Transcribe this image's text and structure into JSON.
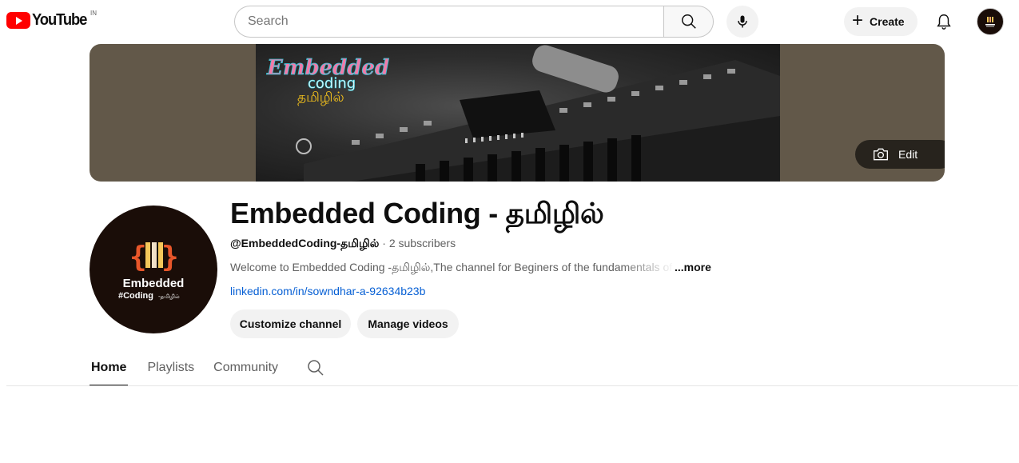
{
  "header": {
    "logo_text": "YouTube",
    "country_code": "IN",
    "search_placeholder": "Search",
    "create_label": "Create",
    "icons": [
      "search-icon",
      "mic-icon",
      "plus-icon",
      "bell-icon"
    ],
    "brand_color": "#ff0000"
  },
  "banner": {
    "title_line1": "Embedded",
    "title_line2": "coding",
    "title_line3": "தமிழில்",
    "edit_label": "Edit"
  },
  "channel": {
    "name": "Embedded Coding - தமிழில்",
    "handle": "@EmbeddedCoding-தமிழில்",
    "separator": " · ",
    "subscribers": "2 subscribers",
    "description": "Welcome to Embedded Coding -தமிழில்,The channel for Beginers of the fundamentals of",
    "more_label": "...more",
    "link": "linkedin.com/in/sowndhar-a-92634b23b",
    "avatar_line1": "Embedded",
    "avatar_line2": "#Coding",
    "avatar_line3": "-தமிழில்",
    "avatar_accent": "#e8562a"
  },
  "actions": {
    "customize_label": "Customize channel",
    "manage_label": "Manage videos"
  },
  "tabs": [
    {
      "label": "Home",
      "active": true
    },
    {
      "label": "Playlists",
      "active": false
    },
    {
      "label": "Community",
      "active": false
    }
  ],
  "link_color": "#065fd4"
}
